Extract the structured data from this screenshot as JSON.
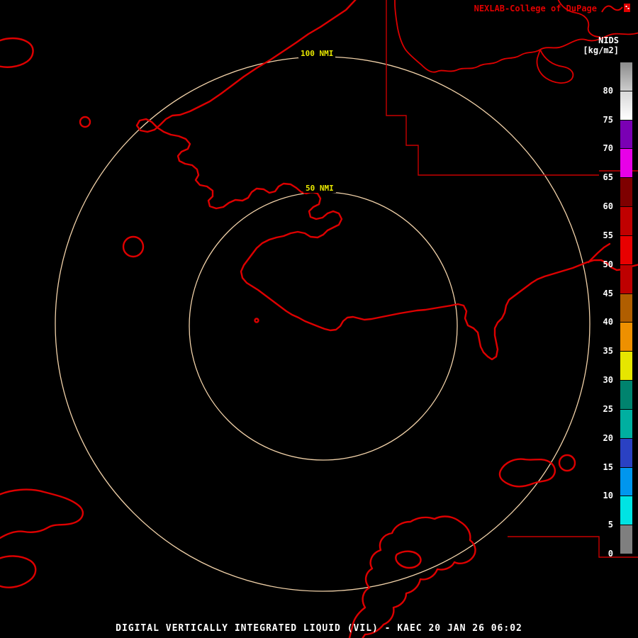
{
  "header": {
    "brand": "NEXLAB-College of DuPage"
  },
  "colorbar": {
    "title": "NIDS",
    "units": "[kg/m2]",
    "min": 0,
    "max": 85,
    "ticks": [
      80,
      75,
      70,
      65,
      60,
      55,
      50,
      45,
      40,
      35,
      30,
      25,
      20,
      15,
      10,
      5,
      0
    ],
    "segments": [
      {
        "from": 0,
        "to": 5,
        "color": "#7F7F7F"
      },
      {
        "from": 5,
        "to": 10,
        "color": "#00E3E3"
      },
      {
        "from": 10,
        "to": 15,
        "color": "#0096EE"
      },
      {
        "from": 15,
        "to": 20,
        "color": "#2A41C3"
      },
      {
        "from": 20,
        "to": 25,
        "color": "#00AFA0"
      },
      {
        "from": 25,
        "to": 30,
        "color": "#00836E"
      },
      {
        "from": 30,
        "to": 35,
        "color": "#E6E600"
      },
      {
        "from": 35,
        "to": 40,
        "color": "#EE9000"
      },
      {
        "from": 40,
        "to": 45,
        "color": "#B05E00"
      },
      {
        "from": 45,
        "to": 50,
        "color": "#BE0000"
      },
      {
        "from": 50,
        "to": 55,
        "color": "#E80000"
      },
      {
        "from": 55,
        "to": 60,
        "color": "#C00000"
      },
      {
        "from": 60,
        "to": 65,
        "color": "#7E0000"
      },
      {
        "from": 65,
        "to": 70,
        "color": "#E800E8"
      },
      {
        "from": 70,
        "to": 75,
        "color": "#7A00B4"
      },
      {
        "from": 75,
        "to": 80,
        "color_top": "#D8D8D8",
        "color_bottom": "#FFFFFF"
      },
      {
        "from": 80,
        "to": 85,
        "color_top": "#8C8C8C",
        "color_bottom": "#CCCCCC"
      }
    ]
  },
  "map": {
    "rings": [
      {
        "label": "100 NMI",
        "radius_nmi": 100
      },
      {
        "label": "50 NMI",
        "radius_nmi": 50
      }
    ]
  },
  "footer": {
    "caption": "DIGITAL VERTICALLY INTEGRATED LIQUID (VIL) - KAEC 20 JAN 26 06:02"
  },
  "colors": {
    "background": "#000000",
    "coast": "#DD0000",
    "boundary": "#C80000",
    "ring": "#F2D2A9",
    "ring_label": "#E8E800",
    "brand": "#E00000",
    "text": "#FFFFFF"
  }
}
